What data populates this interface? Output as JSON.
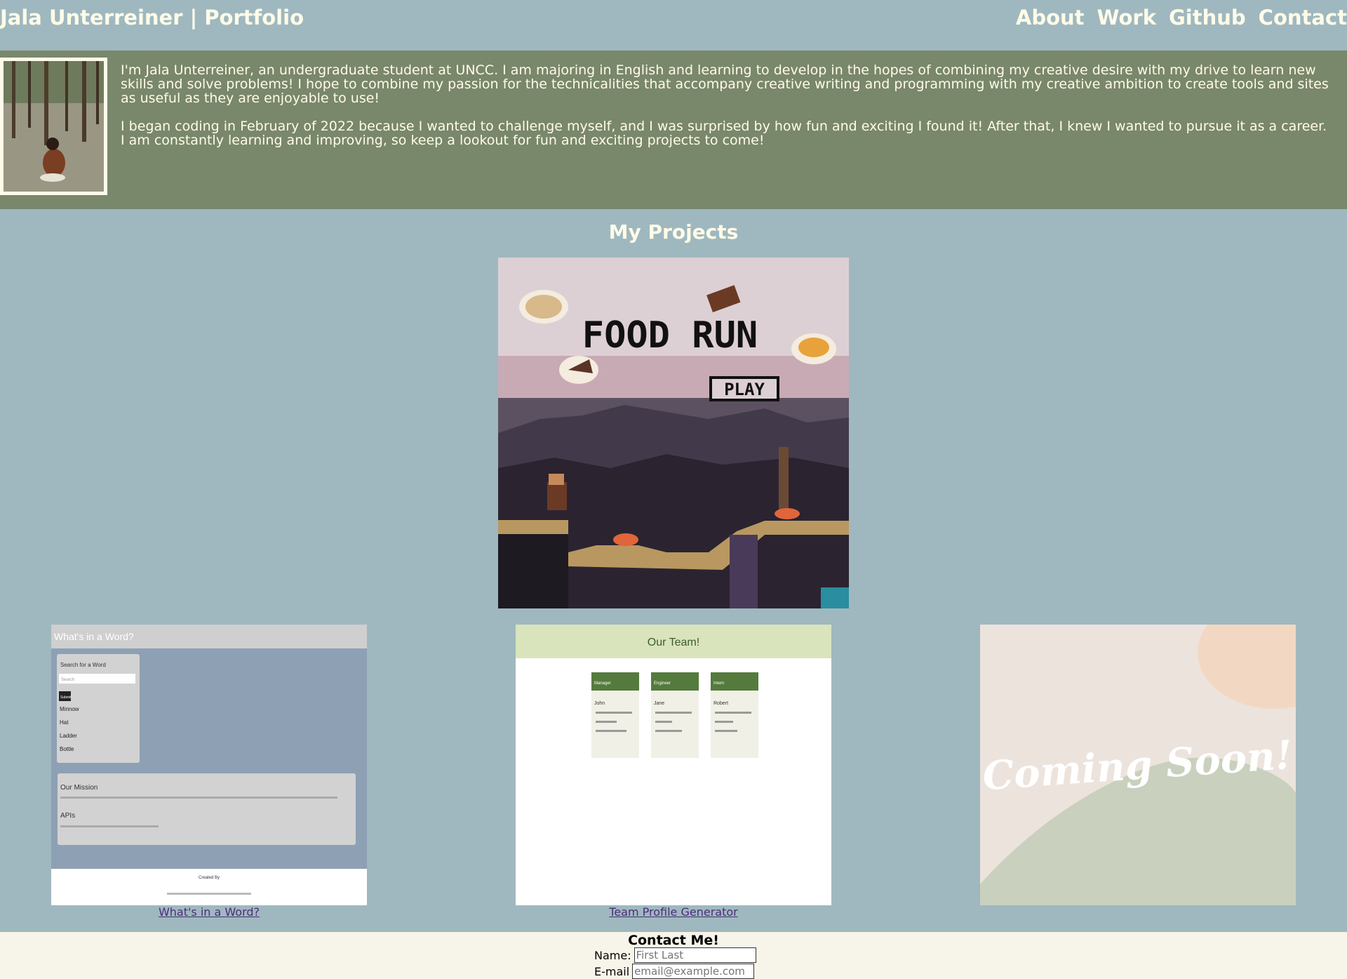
{
  "header": {
    "title": "Jala Unterreiner | Portfolio",
    "nav": [
      "About",
      "Work",
      "Github",
      "Contact"
    ]
  },
  "about": {
    "paragraphs": [
      "I'm Jala Unterreiner, an undergraduate student at UNCC. I am majoring in English and learning to develop in the hopes of combining my creative desire with my drive to learn new skills and solve problems! I hope to combine my passion for the technicalities that accompany creative writing and programming with my creative ambition to create tools and sites as useful as they are enjoyable to use!",
      "I began coding in February of 2022 because I wanted to challenge myself, and I was surprised by how fun and exciting I found it! After that, I knew I wanted to pursue it as a career. I am constantly learning and improving, so keep a lookout for fun and exciting projects to come!"
    ]
  },
  "projects": {
    "title": "My Projects",
    "featured": {
      "game_title": "FOOD RUN",
      "play_label": "PLAY"
    },
    "cards": [
      {
        "link": "What's in a Word?",
        "preview": {
          "header": "What's in a Word?",
          "search_label": "Search for a Word",
          "search_placeholder": "Search",
          "submit": "Submit",
          "words": [
            "Minnow",
            "Hat",
            "Ladder",
            "Bottle"
          ],
          "mission_title": "Our Mission",
          "apis_title": "APIs",
          "footer": "Created By"
        }
      },
      {
        "link": "Team Profile Generator",
        "preview": {
          "header": "Our Team!",
          "members": [
            {
              "role": "Manager",
              "name": "John"
            },
            {
              "role": "Engineer",
              "name": "Jane"
            },
            {
              "role": "Intern",
              "name": "Robert"
            }
          ]
        }
      },
      {
        "link": "",
        "preview": {
          "text": "Coming Soon!"
        }
      }
    ]
  },
  "contact": {
    "title": "Contact Me!",
    "name_label": "Name:",
    "name_placeholder": "First Last",
    "email_label": "E-mail",
    "email_placeholder": "email@example.com"
  },
  "colors": {
    "page_bg": "#9fb8bf",
    "about_bg": "#79876b",
    "cream_text": "#fffbe8",
    "footer_bg": "#f7f4e9",
    "link": "#4a2e7a"
  }
}
